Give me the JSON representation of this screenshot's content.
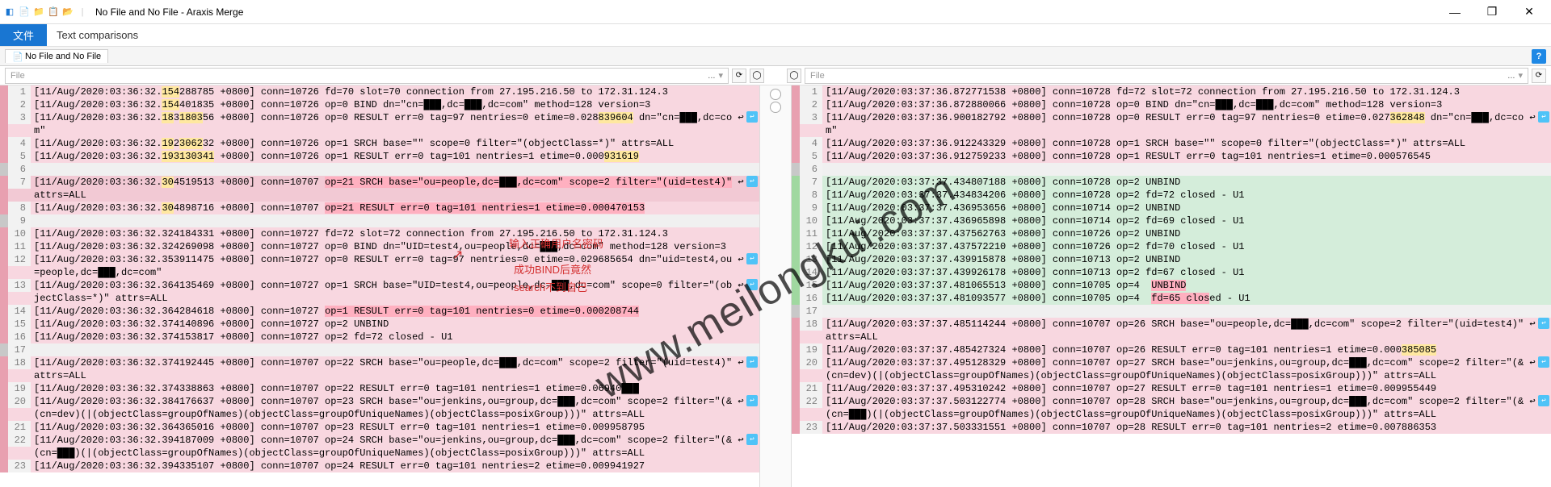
{
  "window": {
    "title": "No File and No File - Araxis Merge"
  },
  "menu": {
    "file": "文件",
    "textcomp": "Text comparisons"
  },
  "tab": {
    "label": "No File and No File"
  },
  "fileinput": {
    "placeholder": "File",
    "dots": "..."
  },
  "watermark": "www.meilongkui.com",
  "annot": {
    "l1": "输入正确用户名密码",
    "l2": "成功BIND后竟然",
    "l3": "search不到自己"
  },
  "left": {
    "rows": [
      {
        "n": 1,
        "cls": "row-pink",
        "txt": "[11/Aug/2020:03:36:32.154288785 +0800] conn=10726 fd=70 slot=70 connection from 27.195.216.50 to 172.31.124.3",
        "hl": [
          [
            "154",
            5
          ]
        ]
      },
      {
        "n": 2,
        "cls": "row-pink",
        "txt": "[11/Aug/2020:03:36:32.154401835 +0800] conn=10726 op=0 BIND dn=\"cn=███,dc=███,dc=com\" method=128 version=3",
        "hl": [
          [
            "154",
            5
          ]
        ]
      },
      {
        "n": 3,
        "cls": "row-pink",
        "txt": "[11/Aug/2020:03:36:32.183180356 +0800] conn=10726 op=0 RESULT err=0 tag=97 nentries=0 etime=0.028839604 dn=\"cn=███,dc=co ↩\nm\"",
        "hl": [
          [
            "18",
            5
          ],
          [
            "1803",
            5
          ],
          [
            "839604",
            5
          ]
        ],
        "wrap": true
      },
      {
        "n": 4,
        "cls": "row-pink",
        "txt": "[11/Aug/2020:03:36:32.192306232 +0800] conn=10726 op=1 SRCH base=\"\" scope=0 filter=\"(objectClass=*)\" attrs=ALL",
        "hl": [
          [
            "19",
            5
          ],
          [
            "3062",
            5
          ]
        ]
      },
      {
        "n": 5,
        "cls": "row-pink",
        "txt": "[11/Aug/2020:03:36:32.193130341 +0800] conn=10726 op=1 RESULT err=0 tag=101 nentries=1 etime=0.000931619",
        "hl": [
          [
            "193130341",
            5
          ],
          [
            "931619",
            5
          ]
        ]
      },
      {
        "n": 6,
        "cls": "row-gray",
        "txt": ""
      },
      {
        "n": 7,
        "cls": "row-pink2",
        "txt": "[11/Aug/2020:03:36:32.304519513 +0800] conn=10707 op=21 SRCH base=\"ou=people,dc=███,dc=com\" scope=2 filter=\"(uid=test4)\" ↩\nattrs=ALL",
        "wrap": true,
        "hl": [
          [
            "30",
            5
          ]
        ],
        "hlspan": [
          [
            "op=21 SRCH base=\"ou=people,dc=███,dc=com\" scope=2 filter=\"(uid=test4)\"",
            "hl-pink"
          ]
        ]
      },
      {
        "n": 8,
        "cls": "row-pink",
        "txt": "[11/Aug/2020:03:36:32.304898716 +0800] conn=10707 op=21 RESULT err=0 tag=101 nentries=1 etime=0.000470153",
        "hl": [
          [
            "30",
            5
          ]
        ],
        "hlspan": [
          [
            "op=21 RESULT err=0 tag=101 nentries=1 etime=0.000470153",
            "hl-pink"
          ]
        ]
      },
      {
        "n": 9,
        "cls": "row-gray",
        "txt": ""
      },
      {
        "n": 10,
        "cls": "row-pink",
        "txt": "[11/Aug/2020:03:36:32.324184331 +0800] conn=10727 fd=72 slot=72 connection from 27.195.216.50 to 172.31.124.3"
      },
      {
        "n": 11,
        "cls": "row-pink",
        "txt": "[11/Aug/2020:03:36:32.324269098 +0800] conn=10727 op=0 BIND dn=\"UID=test4,ou=people,dc=███,dc=com\" method=128 version=3"
      },
      {
        "n": 12,
        "cls": "row-pink",
        "txt": "[11/Aug/2020:03:36:32.353911475 +0800] conn=10727 op=0 RESULT err=0 tag=97 nentries=0 etime=0.029685654 dn=\"uid=test4,ou ↩\n=people,dc=███,dc=com\"",
        "wrap": true
      },
      {
        "n": 13,
        "cls": "row-pink",
        "txt": "[11/Aug/2020:03:36:32.364135469 +0800] conn=10727 op=1 SRCH base=\"UID=test4,ou=people,dc=███,dc=com\" scope=0 filter=\"(ob ↩\njectClass=*)\" attrs=ALL",
        "wrap": true
      },
      {
        "n": 14,
        "cls": "row-pink",
        "txt": "[11/Aug/2020:03:36:32.364284618 +0800] conn=10727 op=1 RESULT err=0 tag=101 nentries=0 etime=0.000208744",
        "hlspan": [
          [
            "op=1 RESULT err=0 tag=101 nentries=0 etime=0.000208744",
            "hl-pink"
          ]
        ]
      },
      {
        "n": 15,
        "cls": "row-pink",
        "txt": "[11/Aug/2020:03:36:32.374140896 +0800] conn=10727 op=2 UNBIND"
      },
      {
        "n": 16,
        "cls": "row-pink",
        "txt": "[11/Aug/2020:03:36:32.374153817 +0800] conn=10727 op=2 fd=72 closed - U1"
      },
      {
        "n": 17,
        "cls": "row-gray",
        "txt": ""
      },
      {
        "n": 18,
        "cls": "row-pink",
        "txt": "[11/Aug/2020:03:36:32.374192445 +0800] conn=10707 op=22 SRCH base=\"ou=people,dc=███,dc=com\" scope=2 filter=\"(uid=test4)\" ↩\nattrs=ALL",
        "wrap": true
      },
      {
        "n": 19,
        "cls": "row-pink",
        "txt": "[11/Aug/2020:03:36:32.374338863 +0800] conn=10707 op=22 RESULT err=0 tag=101 nentries=1 etime=0.06940███"
      },
      {
        "n": 20,
        "cls": "row-pink",
        "txt": "[11/Aug/2020:03:36:32.384176637 +0800] conn=10707 op=23 SRCH base=\"ou=jenkins,ou=group,dc=███,dc=com\" scope=2 filter=\"(& ↩\n(cn=dev)(|(objectClass=groupOfNames)(objectClass=groupOfUniqueNames)(objectClass=posixGroup)))\" attrs=ALL",
        "wrap": true
      },
      {
        "n": 21,
        "cls": "row-pink",
        "txt": "[11/Aug/2020:03:36:32.364365016 +0800] conn=10707 op=23 RESULT err=0 tag=101 nentries=1 etime=0.009958795"
      },
      {
        "n": 22,
        "cls": "row-pink",
        "txt": "[11/Aug/2020:03:36:32.394187009 +0800] conn=10707 op=24 SRCH base=\"ou=jenkins,ou=group,dc=███,dc=com\" scope=2 filter=\"(& ↩\n(cn=███)(|(objectClass=groupOfNames)(objectClass=groupOfUniqueNames)(objectClass=posixGroup)))\" attrs=ALL",
        "wrap": true
      },
      {
        "n": 23,
        "cls": "row-pink",
        "txt": "[11/Aug/2020:03:36:32.394335107 +0800] conn=10707 op=24 RESULT err=0 tag=101 nentries=2 etime=0.009941927"
      }
    ]
  },
  "right": {
    "rows": [
      {
        "n": 1,
        "cls": "row-pink",
        "txt": "[11/Aug/2020:03:37:36.872771538 +0800] conn=10728 fd=72 slot=72 connection from 27.195.216.50 to 172.31.124.3"
      },
      {
        "n": 2,
        "cls": "row-pink",
        "txt": "[11/Aug/2020:03:37:36.872880066 +0800] conn=10728 op=0 BIND dn=\"cn=███,dc=███,dc=com\" method=128 version=3"
      },
      {
        "n": 3,
        "cls": "row-pink",
        "txt": "[11/Aug/2020:03:37:36.900182792 +0800] conn=10728 op=0 RESULT err=0 tag=97 nentries=0 etime=0.027362848 dn=\"cn=███,dc=co ↩\nm\"",
        "wrap": true,
        "hl": [
          [
            "362848",
            5
          ]
        ]
      },
      {
        "n": 4,
        "cls": "row-pink",
        "txt": "[11/Aug/2020:03:37:36.912243329 +0800] conn=10728 op=1 SRCH base=\"\" scope=0 filter=\"(objectClass=*)\" attrs=ALL"
      },
      {
        "n": 5,
        "cls": "row-pink",
        "txt": "[11/Aug/2020:03:37:36.912759233 +0800] conn=10728 op=1 RESULT err=0 tag=101 nentries=1 etime=0.000576545"
      },
      {
        "n": 6,
        "cls": "row-gray",
        "txt": ""
      },
      {
        "n": 7,
        "cls": "row-green",
        "txt": "[11/Aug/2020:03:37:37.434807188 +0800] conn=10728 op=2 UNBIND"
      },
      {
        "n": 8,
        "cls": "row-green",
        "txt": "[11/Aug/2020:03:37:37.434834206 +0800] conn=10728 op=2 fd=72 closed - U1"
      },
      {
        "n": 9,
        "cls": "row-green",
        "txt": "[11/Aug/2020:03:37:37.436953656 +0800] conn=10714 op=2 UNBIND"
      },
      {
        "n": 10,
        "cls": "row-green",
        "txt": "[11/Aug/2020:03:37:37.436965898 +0800] conn=10714 op=2 fd=69 closed - U1"
      },
      {
        "n": 11,
        "cls": "row-green",
        "txt": "[11/Aug/2020:03:37:37.437562763 +0800] conn=10726 op=2 UNBIND"
      },
      {
        "n": 12,
        "cls": "row-green",
        "txt": "[11/Aug/2020:03:37:37.437572210 +0800] conn=10726 op=2 fd=70 closed - U1"
      },
      {
        "n": 13,
        "cls": "row-green",
        "txt": "[11/Aug/2020:03:37:37.439915878 +0800] conn=10713 op=2 UNBIND"
      },
      {
        "n": 14,
        "cls": "row-green",
        "txt": "[11/Aug/2020:03:37:37.439926178 +0800] conn=10713 op=2 fd=67 closed - U1"
      },
      {
        "n": 15,
        "cls": "row-green",
        "txt": "[11/Aug/2020:03:37:37.481065513 +0800] conn=10705 op=4  UNBIND",
        "hlspan": [
          [
            "UNBIND",
            "hl-pink"
          ]
        ]
      },
      {
        "n": 16,
        "cls": "row-green",
        "txt": "[11/Aug/2020:03:37:37.481093577 +0800] conn=10705 op=4  fd=65 closed - U1",
        "hlspan": [
          [
            "fd=65 clos",
            "hl-pink"
          ]
        ]
      },
      {
        "n": 17,
        "cls": "row-gray",
        "txt": ""
      },
      {
        "n": 18,
        "cls": "row-pink",
        "txt": "[11/Aug/2020:03:37:37.485114244 +0800] conn=10707 op=26 SRCH base=\"ou=people,dc=███,dc=com\" scope=2 filter=\"(uid=test4)\" ↩\nattrs=ALL",
        "wrap": true
      },
      {
        "n": 19,
        "cls": "row-pink",
        "txt": "[11/Aug/2020:03:37:37.485427324 +0800] conn=10707 op=26 RESULT err=0 tag=101 nentries=1 etime=0.000385085",
        "hl": [
          [
            "385085",
            5
          ]
        ]
      },
      {
        "n": 20,
        "cls": "row-pink",
        "txt": "[11/Aug/2020:03:37:37.495128329 +0800] conn=10707 op=27 SRCH base=\"ou=jenkins,ou=group,dc=███,dc=com\" scope=2 filter=\"(& ↩\n(cn=dev)(|(objectClass=groupOfNames)(objectClass=groupOfUniqueNames)(objectClass=posixGroup)))\" attrs=ALL",
        "wrap": true
      },
      {
        "n": 21,
        "cls": "row-pink",
        "txt": "[11/Aug/2020:03:37:37.495310242 +0800] conn=10707 op=27 RESULT err=0 tag=101 nentries=1 etime=0.009955449"
      },
      {
        "n": 22,
        "cls": "row-pink",
        "txt": "[11/Aug/2020:03:37:37.503122774 +0800] conn=10707 op=28 SRCH base=\"ou=jenkins,ou=group,dc=███,dc=com\" scope=2 filter=\"(& ↩\n(cn=███)(|(objectClass=groupOfNames)(objectClass=groupOfUniqueNames)(objectClass=posixGroup)))\" attrs=ALL",
        "wrap": true
      },
      {
        "n": 23,
        "cls": "row-pink",
        "txt": "[11/Aug/2020:03:37:37.503331551 +0800] conn=10707 op=28 RESULT err=0 tag=101 nentries=2 etime=0.007886353"
      }
    ]
  }
}
